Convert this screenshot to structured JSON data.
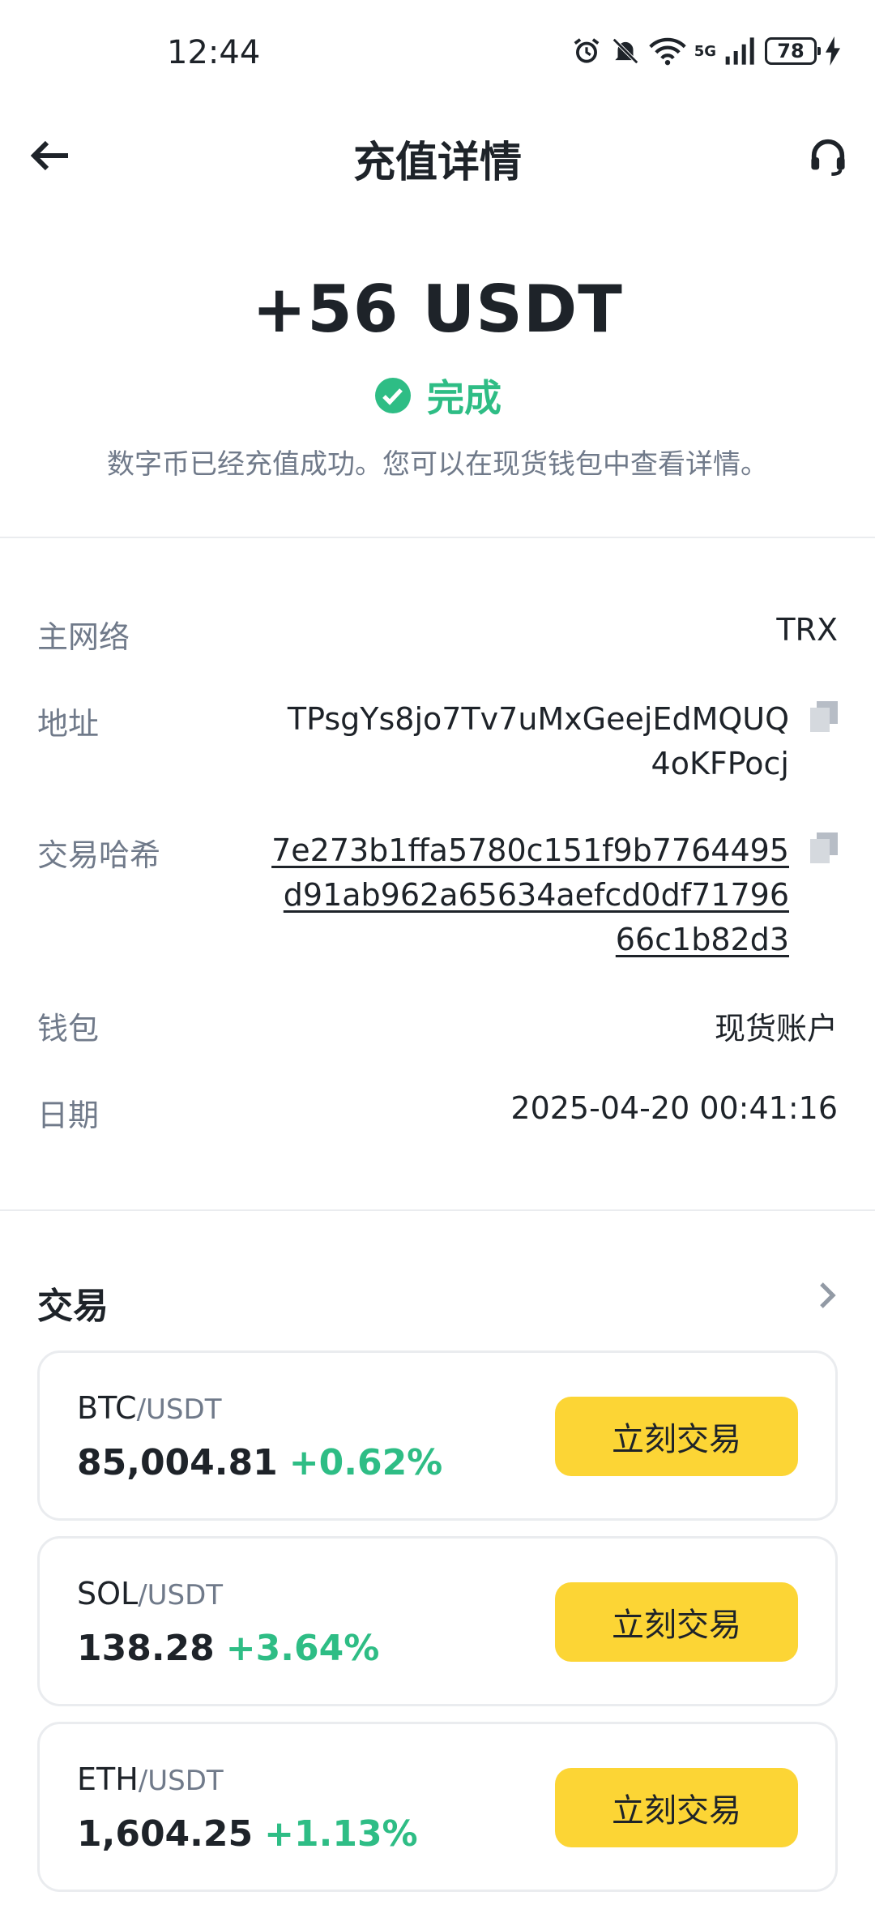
{
  "status_bar": {
    "time": "12:44",
    "battery": "78",
    "network": "5G"
  },
  "header": {
    "title": "充值详情"
  },
  "summary": {
    "amount": "+56 USDT",
    "status": "完成",
    "description": "数字币已经充值成功。您可以在现货钱包中查看详情。"
  },
  "details": {
    "network_label": "主网络",
    "network_value": "TRX",
    "address_label": "地址",
    "address_value": "TPsgYs8jo7Tv7uMxGeejEdMQUQ4oKFPocj",
    "hash_label": "交易哈希",
    "hash_value": "7e273b1ffa5780c151f9b7764495d91ab962a65634aefcd0df7179666c1b82d3",
    "wallet_label": "钱包",
    "wallet_value": "现货账户",
    "date_label": "日期",
    "date_value": "2025-04-20 00:41:16"
  },
  "trade": {
    "title": "交易",
    "items": [
      {
        "base": "BTC",
        "quote": "/USDT",
        "price": "85,004.81",
        "change": "+0.62%",
        "button": "立刻交易"
      },
      {
        "base": "SOL",
        "quote": "/USDT",
        "price": "138.28",
        "change": "+3.64%",
        "button": "立刻交易"
      },
      {
        "base": "ETH",
        "quote": "/USDT",
        "price": "1,604.25",
        "change": "+1.13%",
        "button": "立刻交易"
      }
    ]
  },
  "colors": {
    "positive": "#2ebd85",
    "accent": "#fcd535",
    "text": "#1e2329",
    "muted": "#707a8a"
  }
}
